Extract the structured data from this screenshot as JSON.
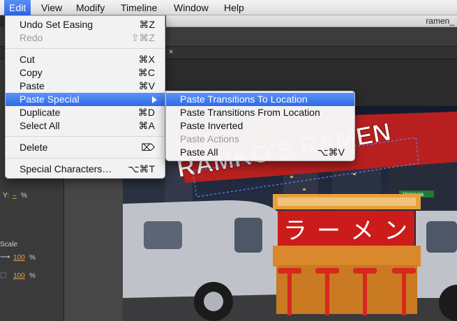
{
  "menubar": {
    "items": [
      {
        "label": "Edit",
        "active": true
      },
      {
        "label": "View"
      },
      {
        "label": "Modify"
      },
      {
        "label": "Timeline"
      },
      {
        "label": "Window"
      },
      {
        "label": "Help"
      }
    ]
  },
  "document": {
    "title": "ramen_"
  },
  "edit_menu": {
    "items": [
      {
        "label": "Undo Set Easing",
        "shortcut": "⌘Z",
        "enabled": true
      },
      {
        "label": "Redo",
        "shortcut": "⇧⌘Z",
        "enabled": false
      },
      {
        "label": "Cut",
        "shortcut": "⌘X",
        "enabled": true
      },
      {
        "label": "Copy",
        "shortcut": "⌘C",
        "enabled": true
      },
      {
        "label": "Paste",
        "shortcut": "⌘V",
        "enabled": true
      },
      {
        "label": "Paste Special",
        "shortcut": "",
        "enabled": true,
        "highlighted": true,
        "has_submenu": true
      },
      {
        "label": "Duplicate",
        "shortcut": "⌘D",
        "enabled": true
      },
      {
        "label": "Select All",
        "shortcut": "⌘A",
        "enabled": true
      },
      {
        "label": "Delete",
        "shortcut": "⌦",
        "enabled": true
      },
      {
        "label": "Special Characters…",
        "shortcut": "⌥⌘T",
        "enabled": true
      }
    ]
  },
  "paste_special_menu": {
    "items": [
      {
        "label": "Paste Transitions To Location",
        "shortcut": "",
        "enabled": true,
        "highlighted": true
      },
      {
        "label": "Paste Transitions From Location",
        "shortcut": "",
        "enabled": true
      },
      {
        "label": "Paste Inverted",
        "shortcut": "",
        "enabled": true
      },
      {
        "label": "Paste Actions",
        "shortcut": "",
        "enabled": false
      },
      {
        "label": "Paste All",
        "shortcut": "⌥⌘V",
        "enabled": true
      }
    ]
  },
  "properties_panel": {
    "y_label": "Y:",
    "y_value": "–",
    "y_unit": "%",
    "scale_label": "Scale",
    "scale_x": "100",
    "scale_y": "100",
    "scale_unit": "%"
  },
  "stage": {
    "sign_text": "RAMKO'S RAMEN",
    "banner_chars": [
      "ラ",
      "ー",
      "メ",
      "ン"
    ],
    "street_sign": "Valencia"
  },
  "colors": {
    "menu_highlight": "#3a74ee",
    "banner_red": "#cc1b1b",
    "van_silver": "#c9ccd2"
  }
}
